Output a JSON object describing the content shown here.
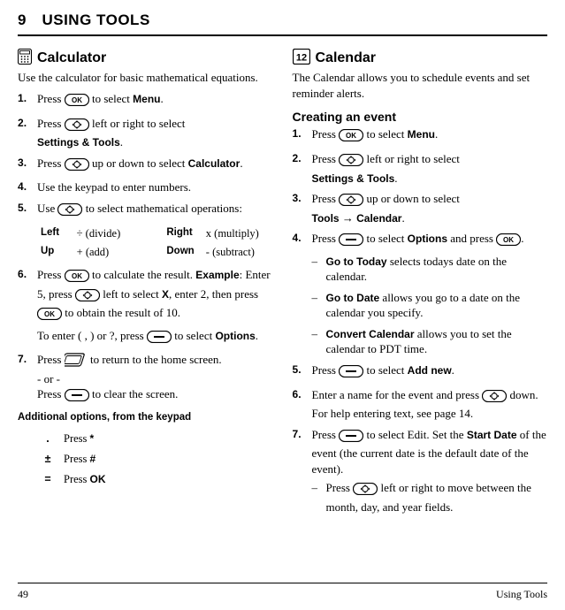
{
  "chapter": {
    "number": "9",
    "title": "USING TOOLS"
  },
  "calc": {
    "heading": "Calculator",
    "intro": "Use the calculator for basic mathematical equations.",
    "steps": {
      "s1a": "Press ",
      "s1b": " to select ",
      "s1c": "Menu",
      "s1d": ".",
      "s2a": "Press ",
      "s2b": " left or right to select ",
      "s2c": "Settings & Tools",
      "s2d": ".",
      "s3a": "Press ",
      "s3b": " up or down to select ",
      "s3c": "Calculator",
      "s3d": ".",
      "s4": "Use the keypad to enter numbers.",
      "s5a": "Use ",
      "s5b": " to select mathematical operations:",
      "s6a": "Press ",
      "s6b": " to calculate the result. ",
      "s6c": "Example",
      "s6d": ": Enter 5, press ",
      "s6e": " left to select ",
      "s6f": "X",
      "s6g": ", enter 2, then press ",
      "s6h": " to obtain the result of 10.",
      "s6i": "To enter ( , ) or ?, press ",
      "s6j": " to select ",
      "s6k": "Options",
      "s6l": ".",
      "s7a": "Press ",
      "s7b": " to return to the home screen.",
      "s7c": "- or -",
      "s7d": "Press ",
      "s7e": " to clear the screen."
    },
    "ops": {
      "left_k": "Left",
      "left_v": "÷ (divide)",
      "right_k": "Right",
      "right_v": "x (multiply)",
      "up_k": "Up",
      "up_v": "+ (add)",
      "down_k": "Down",
      "down_v": "- (subtract)"
    },
    "addl_head": "Additional options, from the keypad",
    "addl": {
      "dot_s": ".",
      "dot_t": "Press ",
      "dot_b": "*",
      "pm_s": "±",
      "pm_t": "Press ",
      "pm_b": "#",
      "eq_s": "=",
      "eq_t": "Press ",
      "eq_b": "OK"
    }
  },
  "cal": {
    "heading": "Calendar",
    "intro": "The Calendar allows you to schedule events and set reminder alerts.",
    "create_head": "Creating an event",
    "steps": {
      "s1a": "Press ",
      "s1b": " to select ",
      "s1c": "Menu",
      "s1d": ".",
      "s2a": "Press ",
      "s2b": " left or right to select ",
      "s2c": "Settings & Tools",
      "s2d": ".",
      "s3a": "Press ",
      "s3b": " up or down to select ",
      "s3c": "Tools",
      "s3d": " → ",
      "s3e": "Calendar",
      "s3f": ".",
      "s4a": "Press ",
      "s4b": " to select ",
      "s4c": "Options",
      "s4d": " and press ",
      "s4e": ".",
      "s4o1a": "Go to Today",
      "s4o1b": " selects todays date on the calendar.",
      "s4o2a": "Go to Date",
      "s4o2b": " allows you go to a date on the calendar you specify.",
      "s4o3a": "Convert Calendar",
      "s4o3b": " allows you to set the calendar to PDT time.",
      "s5a": "Press ",
      "s5b": " to select ",
      "s5c": "Add new",
      "s5d": ".",
      "s6a": "Enter a name for the event and press ",
      "s6b": " down. For help entering text, see page 14.",
      "s7a": "Press ",
      "s7b": " to select Edit. Set the ",
      "s7c": "Start Date",
      "s7d": " of the event (the current date is the default date of the event).",
      "s7e": "Press ",
      "s7f": " left or right to move between the month, day, and year fields."
    }
  },
  "footer": {
    "page": "49",
    "section": "Using Tools"
  }
}
